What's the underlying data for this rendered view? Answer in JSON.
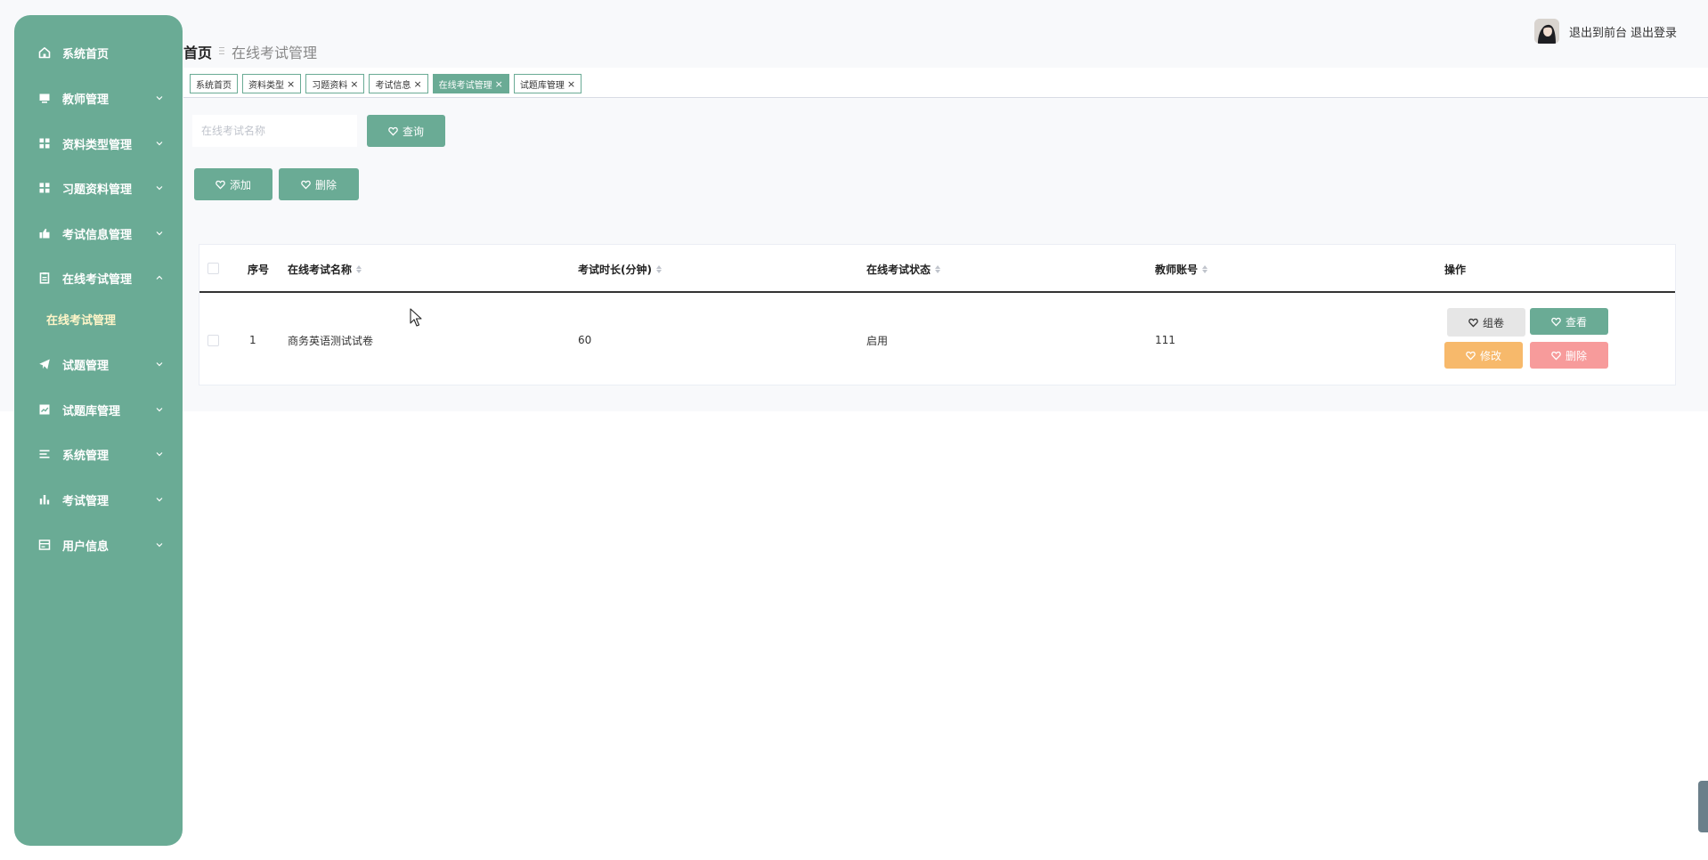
{
  "sidebar": {
    "items": [
      {
        "label": "系统首页",
        "icon": "home-icon",
        "expandable": false
      },
      {
        "label": "教师管理",
        "icon": "monitor-icon",
        "expandable": true
      },
      {
        "label": "资料类型管理",
        "icon": "grid-icon",
        "expandable": true
      },
      {
        "label": "习题资料管理",
        "icon": "grid-icon",
        "expandable": true
      },
      {
        "label": "考试信息管理",
        "icon": "thumb-icon",
        "expandable": true
      },
      {
        "label": "在线考试管理",
        "icon": "clipboard-icon",
        "expandable": true,
        "expanded": true
      },
      {
        "label": "试题管理",
        "icon": "send-icon",
        "expandable": true
      },
      {
        "label": "试题库管理",
        "icon": "chart-box-icon",
        "expandable": true
      },
      {
        "label": "系统管理",
        "icon": "list-icon",
        "expandable": true
      },
      {
        "label": "考试管理",
        "icon": "bar-chart-icon",
        "expandable": true
      },
      {
        "label": "用户信息",
        "icon": "card-icon",
        "expandable": true
      }
    ],
    "active_sub_item": "在线考试管理"
  },
  "header": {
    "breadcrumb_home": "首页",
    "breadcrumb_current": "在线考试管理",
    "link_frontend": "退出到前台",
    "link_logout": "退出登录"
  },
  "tabs": [
    {
      "label": "系统首页",
      "closable": false,
      "active": false
    },
    {
      "label": "资料类型",
      "closable": true,
      "active": false
    },
    {
      "label": "习题资料",
      "closable": true,
      "active": false
    },
    {
      "label": "考试信息",
      "closable": true,
      "active": false
    },
    {
      "label": "在线考试管理",
      "closable": true,
      "active": true
    },
    {
      "label": "试题库管理",
      "closable": true,
      "active": false
    }
  ],
  "search": {
    "placeholder": "在线考试名称",
    "query_label": "查询"
  },
  "actions": {
    "add_label": "添加",
    "delete_label": "删除"
  },
  "table": {
    "headers": {
      "index": "序号",
      "name": "在线考试名称",
      "duration": "考试时长(分钟)",
      "status": "在线考试状态",
      "teacher": "教师账号",
      "ops": "操作"
    },
    "rows": [
      {
        "index": "1",
        "name": "商务英语测试试卷",
        "duration": "60",
        "status": "启用",
        "teacher": "111",
        "ops": {
          "compose": "组卷",
          "view": "查看",
          "edit": "修改",
          "delete": "删除"
        }
      }
    ]
  },
  "colors": {
    "accent": "#6aab95",
    "orange": "#f7b96b",
    "red": "#f79b9b",
    "active_sub_text": "#fff5c8"
  }
}
